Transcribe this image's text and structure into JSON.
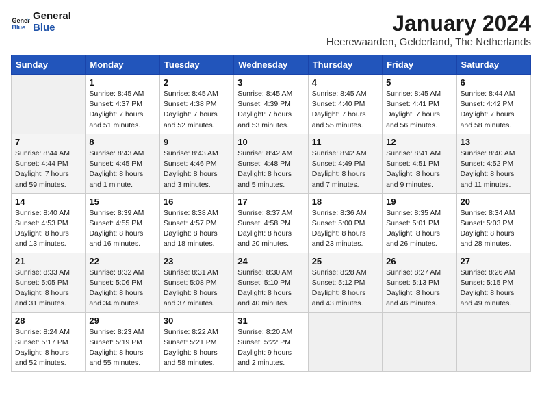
{
  "header": {
    "logo_line1": "General",
    "logo_line2": "Blue",
    "title": "January 2024",
    "subtitle": "Heerewaarden, Gelderland, The Netherlands"
  },
  "days_of_week": [
    "Sunday",
    "Monday",
    "Tuesday",
    "Wednesday",
    "Thursday",
    "Friday",
    "Saturday"
  ],
  "weeks": [
    [
      {
        "day": "",
        "sunrise": "",
        "sunset": "",
        "daylight": "",
        "empty": true
      },
      {
        "day": "1",
        "sunrise": "Sunrise: 8:45 AM",
        "sunset": "Sunset: 4:37 PM",
        "daylight": "Daylight: 7 hours and 51 minutes."
      },
      {
        "day": "2",
        "sunrise": "Sunrise: 8:45 AM",
        "sunset": "Sunset: 4:38 PM",
        "daylight": "Daylight: 7 hours and 52 minutes."
      },
      {
        "day": "3",
        "sunrise": "Sunrise: 8:45 AM",
        "sunset": "Sunset: 4:39 PM",
        "daylight": "Daylight: 7 hours and 53 minutes."
      },
      {
        "day": "4",
        "sunrise": "Sunrise: 8:45 AM",
        "sunset": "Sunset: 4:40 PM",
        "daylight": "Daylight: 7 hours and 55 minutes."
      },
      {
        "day": "5",
        "sunrise": "Sunrise: 8:45 AM",
        "sunset": "Sunset: 4:41 PM",
        "daylight": "Daylight: 7 hours and 56 minutes."
      },
      {
        "day": "6",
        "sunrise": "Sunrise: 8:44 AM",
        "sunset": "Sunset: 4:42 PM",
        "daylight": "Daylight: 7 hours and 58 minutes."
      }
    ],
    [
      {
        "day": "7",
        "sunrise": "Sunrise: 8:44 AM",
        "sunset": "Sunset: 4:44 PM",
        "daylight": "Daylight: 7 hours and 59 minutes."
      },
      {
        "day": "8",
        "sunrise": "Sunrise: 8:43 AM",
        "sunset": "Sunset: 4:45 PM",
        "daylight": "Daylight: 8 hours and 1 minute."
      },
      {
        "day": "9",
        "sunrise": "Sunrise: 8:43 AM",
        "sunset": "Sunset: 4:46 PM",
        "daylight": "Daylight: 8 hours and 3 minutes."
      },
      {
        "day": "10",
        "sunrise": "Sunrise: 8:42 AM",
        "sunset": "Sunset: 4:48 PM",
        "daylight": "Daylight: 8 hours and 5 minutes."
      },
      {
        "day": "11",
        "sunrise": "Sunrise: 8:42 AM",
        "sunset": "Sunset: 4:49 PM",
        "daylight": "Daylight: 8 hours and 7 minutes."
      },
      {
        "day": "12",
        "sunrise": "Sunrise: 8:41 AM",
        "sunset": "Sunset: 4:51 PM",
        "daylight": "Daylight: 8 hours and 9 minutes."
      },
      {
        "day": "13",
        "sunrise": "Sunrise: 8:40 AM",
        "sunset": "Sunset: 4:52 PM",
        "daylight": "Daylight: 8 hours and 11 minutes."
      }
    ],
    [
      {
        "day": "14",
        "sunrise": "Sunrise: 8:40 AM",
        "sunset": "Sunset: 4:53 PM",
        "daylight": "Daylight: 8 hours and 13 minutes."
      },
      {
        "day": "15",
        "sunrise": "Sunrise: 8:39 AM",
        "sunset": "Sunset: 4:55 PM",
        "daylight": "Daylight: 8 hours and 16 minutes."
      },
      {
        "day": "16",
        "sunrise": "Sunrise: 8:38 AM",
        "sunset": "Sunset: 4:57 PM",
        "daylight": "Daylight: 8 hours and 18 minutes."
      },
      {
        "day": "17",
        "sunrise": "Sunrise: 8:37 AM",
        "sunset": "Sunset: 4:58 PM",
        "daylight": "Daylight: 8 hours and 20 minutes."
      },
      {
        "day": "18",
        "sunrise": "Sunrise: 8:36 AM",
        "sunset": "Sunset: 5:00 PM",
        "daylight": "Daylight: 8 hours and 23 minutes."
      },
      {
        "day": "19",
        "sunrise": "Sunrise: 8:35 AM",
        "sunset": "Sunset: 5:01 PM",
        "daylight": "Daylight: 8 hours and 26 minutes."
      },
      {
        "day": "20",
        "sunrise": "Sunrise: 8:34 AM",
        "sunset": "Sunset: 5:03 PM",
        "daylight": "Daylight: 8 hours and 28 minutes."
      }
    ],
    [
      {
        "day": "21",
        "sunrise": "Sunrise: 8:33 AM",
        "sunset": "Sunset: 5:05 PM",
        "daylight": "Daylight: 8 hours and 31 minutes."
      },
      {
        "day": "22",
        "sunrise": "Sunrise: 8:32 AM",
        "sunset": "Sunset: 5:06 PM",
        "daylight": "Daylight: 8 hours and 34 minutes."
      },
      {
        "day": "23",
        "sunrise": "Sunrise: 8:31 AM",
        "sunset": "Sunset: 5:08 PM",
        "daylight": "Daylight: 8 hours and 37 minutes."
      },
      {
        "day": "24",
        "sunrise": "Sunrise: 8:30 AM",
        "sunset": "Sunset: 5:10 PM",
        "daylight": "Daylight: 8 hours and 40 minutes."
      },
      {
        "day": "25",
        "sunrise": "Sunrise: 8:28 AM",
        "sunset": "Sunset: 5:12 PM",
        "daylight": "Daylight: 8 hours and 43 minutes."
      },
      {
        "day": "26",
        "sunrise": "Sunrise: 8:27 AM",
        "sunset": "Sunset: 5:13 PM",
        "daylight": "Daylight: 8 hours and 46 minutes."
      },
      {
        "day": "27",
        "sunrise": "Sunrise: 8:26 AM",
        "sunset": "Sunset: 5:15 PM",
        "daylight": "Daylight: 8 hours and 49 minutes."
      }
    ],
    [
      {
        "day": "28",
        "sunrise": "Sunrise: 8:24 AM",
        "sunset": "Sunset: 5:17 PM",
        "daylight": "Daylight: 8 hours and 52 minutes."
      },
      {
        "day": "29",
        "sunrise": "Sunrise: 8:23 AM",
        "sunset": "Sunset: 5:19 PM",
        "daylight": "Daylight: 8 hours and 55 minutes."
      },
      {
        "day": "30",
        "sunrise": "Sunrise: 8:22 AM",
        "sunset": "Sunset: 5:21 PM",
        "daylight": "Daylight: 8 hours and 58 minutes."
      },
      {
        "day": "31",
        "sunrise": "Sunrise: 8:20 AM",
        "sunset": "Sunset: 5:22 PM",
        "daylight": "Daylight: 9 hours and 2 minutes."
      },
      {
        "day": "",
        "sunrise": "",
        "sunset": "",
        "daylight": "",
        "empty": true
      },
      {
        "day": "",
        "sunrise": "",
        "sunset": "",
        "daylight": "",
        "empty": true
      },
      {
        "day": "",
        "sunrise": "",
        "sunset": "",
        "daylight": "",
        "empty": true
      }
    ]
  ]
}
